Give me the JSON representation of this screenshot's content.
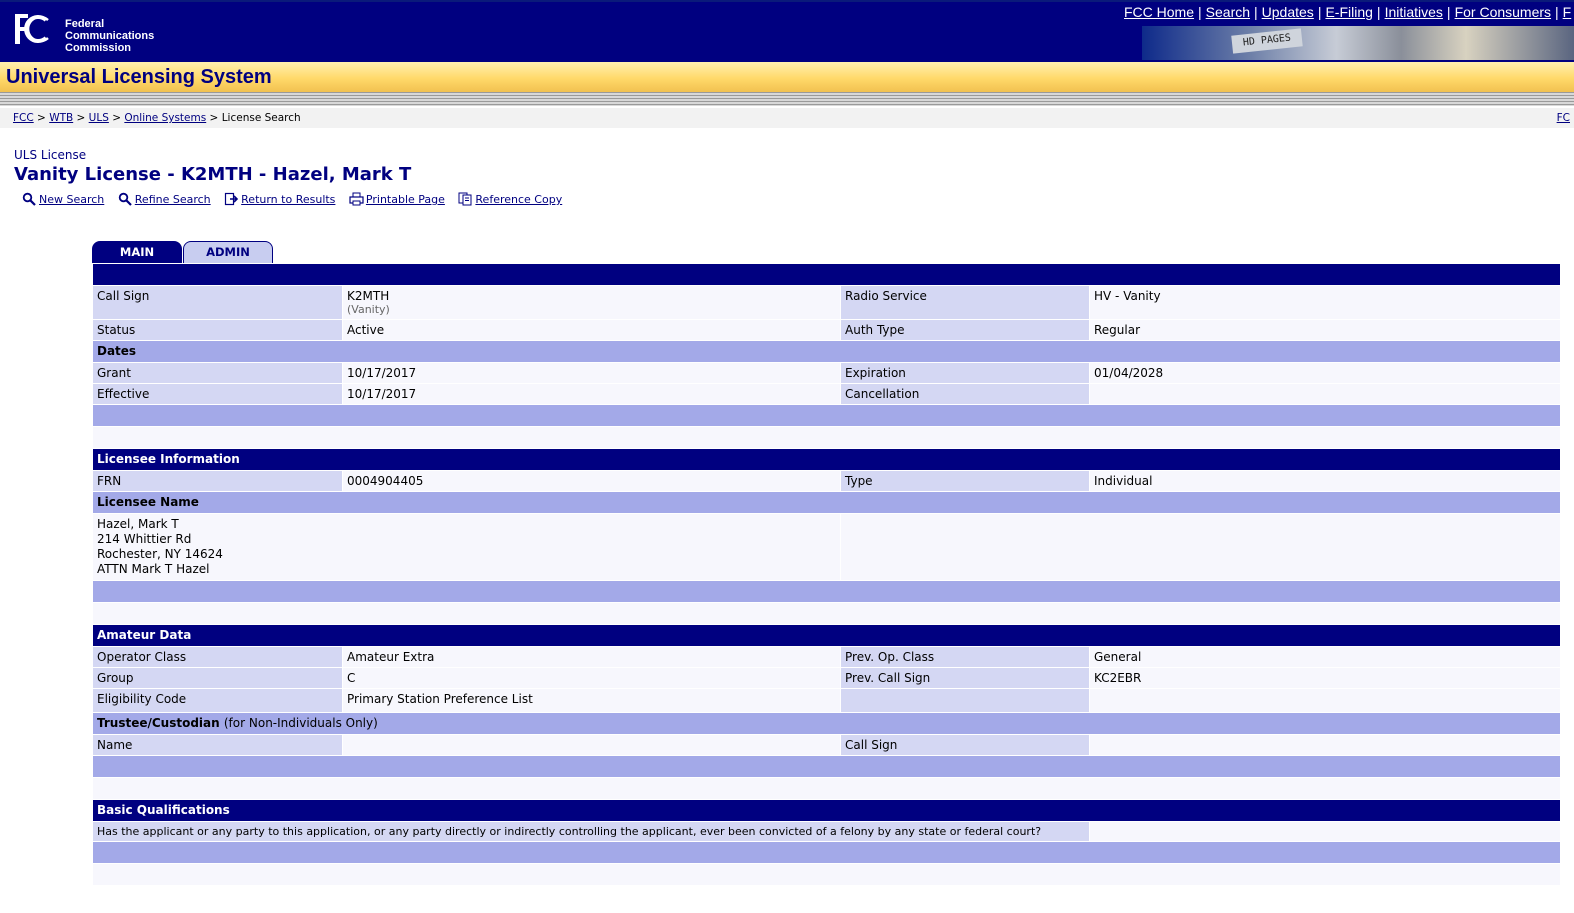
{
  "header": {
    "agency_lines": [
      "Federal",
      "Communications",
      "Commission"
    ],
    "nav": [
      "FCC Home",
      "Search",
      "Updates",
      "E-Filing",
      "Initiatives",
      "For Consumers",
      "F"
    ],
    "photo_label": "HD PAGES",
    "system_title": "Universal Licensing System"
  },
  "breadcrumb": {
    "items": [
      "FCC",
      "WTB",
      "ULS",
      "Online Systems"
    ],
    "current": "License Search",
    "right_link": "FC"
  },
  "page": {
    "pre_title": "ULS License",
    "title": "Vanity License - K2MTH - Hazel, Mark T"
  },
  "actions": {
    "new_search": "New Search",
    "refine_search": "Refine Search",
    "return_results": "Return to Results",
    "printable": "Printable Page",
    "reference": "Reference Copy"
  },
  "tabs": {
    "main": "MAIN",
    "admin": "ADMIN"
  },
  "license": {
    "call_sign_label": "Call Sign",
    "call_sign": "K2MTH",
    "call_sign_sub": "(Vanity)",
    "radio_service_label": "Radio Service",
    "radio_service": "HV - Vanity",
    "status_label": "Status",
    "status": "Active",
    "auth_type_label": "Auth Type",
    "auth_type": "Regular",
    "dates_label": "Dates",
    "grant_label": "Grant",
    "grant": "10/17/2017",
    "expiration_label": "Expiration",
    "expiration": "01/04/2028",
    "effective_label": "Effective",
    "effective": "10/17/2017",
    "cancellation_label": "Cancellation",
    "cancellation": ""
  },
  "licensee": {
    "section": "Licensee Information",
    "frn_label": "FRN",
    "frn": "0004904405",
    "type_label": "Type",
    "type": "Individual",
    "name_label": "Licensee Name",
    "name": "Hazel, Mark T",
    "street": "214 Whittier Rd",
    "city": "Rochester, NY 14624",
    "attn": "ATTN Mark T Hazel"
  },
  "amateur": {
    "section": "Amateur Data",
    "operator_class_label": "Operator Class",
    "operator_class": "Amateur Extra",
    "prev_op_class_label": "Prev. Op. Class",
    "prev_op_class": "General",
    "group_label": "Group",
    "group": "C",
    "prev_call_label": "Prev. Call Sign",
    "prev_call": "KC2EBR",
    "eligibility_label": "Eligibility Code",
    "eligibility": "Primary Station Preference List",
    "trustee_label": "Trustee/Custodian",
    "trustee_note": "(for Non-Individuals Only)",
    "name_label": "Name",
    "call_sign_label": "Call Sign"
  },
  "qualifications": {
    "section": "Basic Qualifications",
    "question": "Has the applicant or any party to this application, or any party directly or indirectly controlling the applicant, ever been convicted of a felony by any state or federal court?"
  },
  "colors": {
    "navy": "#000080",
    "label_bg": "#d4d7f3",
    "section_bg": "#a3a9e8",
    "band_gold": "#ffd96a"
  }
}
